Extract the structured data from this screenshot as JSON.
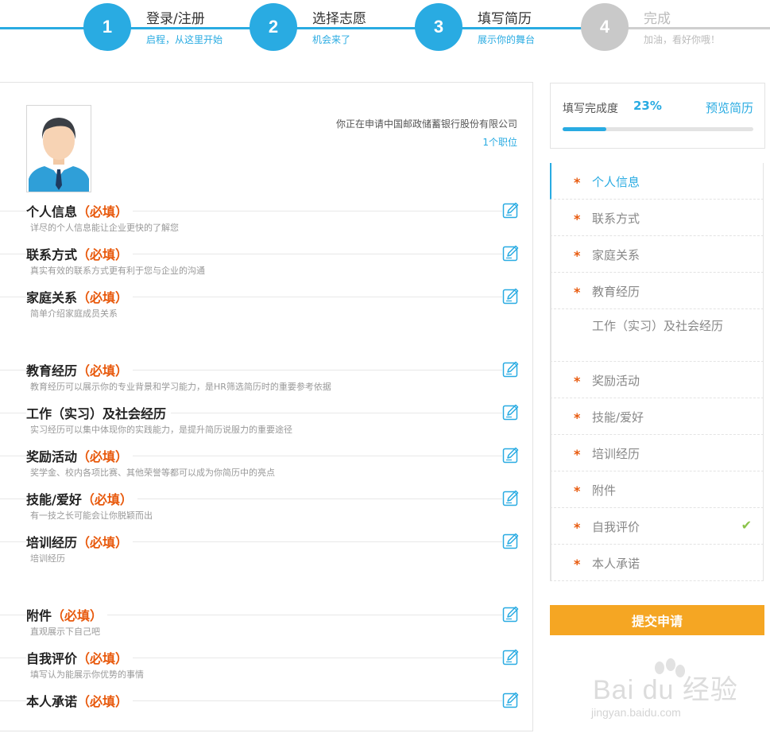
{
  "steps": [
    {
      "num": "1",
      "title": "登录/注册",
      "sub": "启程，从这里开始"
    },
    {
      "num": "2",
      "title": "选择志愿",
      "sub": "机会来了"
    },
    {
      "num": "3",
      "title": "填写简历",
      "sub": "展示你的舞台"
    },
    {
      "num": "4",
      "title": "完成",
      "sub": "加油，看好你哦！"
    }
  ],
  "apply": {
    "company_text": "你正在申请中国邮政储蓄银行股份有限公司",
    "position_count": "1个职位"
  },
  "required_mark": "（必填）",
  "sections": [
    {
      "title": "个人信息",
      "desc": "详尽的个人信息能让企业更快的了解您",
      "required": true
    },
    {
      "title": "联系方式",
      "desc": "真实有效的联系方式更有利于您与企业的沟通",
      "required": true
    },
    {
      "title": "家庭关系",
      "desc": "简单介绍家庭成员关系",
      "required": true
    },
    {
      "title": "教育经历",
      "desc": "教育经历可以展示你的专业背景和学习能力，是HR筛选简历时的重要参考依据",
      "required": true
    },
    {
      "title": "工作（实习）及社会经历",
      "desc": "实习经历可以集中体现你的实践能力，是提升简历说服力的重要途径",
      "required": false
    },
    {
      "title": "奖励活动",
      "desc": "奖学金、校内各项比赛、其他荣誉等都可以成为你简历中的亮点",
      "required": true
    },
    {
      "title": "技能/爱好",
      "desc": "有一技之长可能会让你脱颖而出",
      "required": true
    },
    {
      "title": "培训经历",
      "desc": "培训经历",
      "required": true
    },
    {
      "title": "附件",
      "desc": "直观展示下自己吧",
      "required": true
    },
    {
      "title": "自我评价",
      "desc": "填写认为能展示你优势的事情",
      "required": true
    },
    {
      "title": "本人承诺",
      "desc": "",
      "required": true
    }
  ],
  "completion": {
    "label": "填写完成度",
    "percent_text": "23%",
    "percent": 23,
    "preview_label": "预览简历"
  },
  "nav_items": [
    {
      "label": "个人信息",
      "star": true,
      "active": true,
      "done": false
    },
    {
      "label": "联系方式",
      "star": true,
      "active": false,
      "done": false
    },
    {
      "label": "家庭关系",
      "star": true,
      "active": false,
      "done": false
    },
    {
      "label": "教育经历",
      "star": true,
      "active": false,
      "done": false
    },
    {
      "label": "工作（实习）及社会经历",
      "star": false,
      "active": false,
      "done": false
    },
    {
      "label": "奖励活动",
      "star": true,
      "active": false,
      "done": false
    },
    {
      "label": "技能/爱好",
      "star": true,
      "active": false,
      "done": false
    },
    {
      "label": "培训经历",
      "star": true,
      "active": false,
      "done": false
    },
    {
      "label": "附件",
      "star": true,
      "active": false,
      "done": false
    },
    {
      "label": "自我评价",
      "star": true,
      "active": false,
      "done": true
    },
    {
      "label": "本人承诺",
      "star": true,
      "active": false,
      "done": false
    }
  ],
  "submit_label": "提交申请",
  "watermark": {
    "main": "Bai du 经验",
    "sub": "jingyan.baidu.com"
  },
  "colors": {
    "accent": "#29abe2",
    "required": "#e8590c",
    "submit": "#f5a623",
    "check": "#8bc34a",
    "inactive": "#c9c9c9"
  },
  "icons": {
    "edit": "edit-icon",
    "check": "check-icon",
    "avatar": "user-avatar"
  }
}
